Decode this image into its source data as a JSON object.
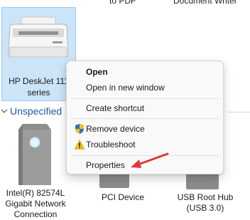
{
  "top_labels": {
    "left": "to PDF",
    "right": "Document Writer"
  },
  "selected_device": {
    "label": "HP DeskJet 111\nseries"
  },
  "section": {
    "title": "Unspecified",
    "chevron": "chevron-down-icon"
  },
  "devices": [
    {
      "label": "Intel(R) 82574L\nGigabit Network\nConnection"
    },
    {
      "label": "PCI Device"
    },
    {
      "label": "USB Root Hub\n(USB 3.0)"
    }
  ],
  "context_menu": {
    "items": [
      {
        "label": "Open",
        "default": true,
        "icon": null
      },
      {
        "label": "Open in new window",
        "icon": null
      },
      {
        "label": "Create shortcut",
        "icon": null
      },
      {
        "label": "Remove device",
        "icon": "uac-shield-icon"
      },
      {
        "label": "Troubleshoot",
        "icon": "warning-icon"
      },
      {
        "label": "Properties",
        "icon": null
      }
    ]
  },
  "annotation": {
    "arrow_color": "#e0383e"
  },
  "colors": {
    "selection": "#cce4f7",
    "section_header": "#1f5aa6"
  }
}
